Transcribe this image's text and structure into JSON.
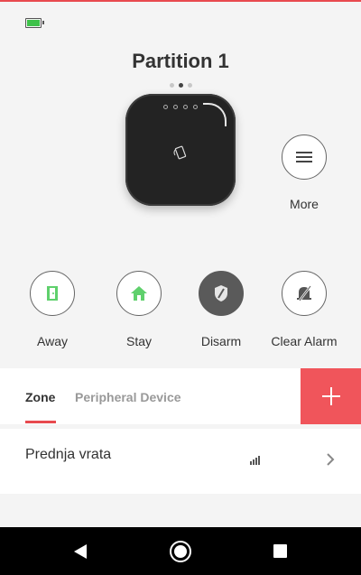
{
  "status": {
    "battery_icon": "battery-full-icon",
    "accent_color": "#e84a4f"
  },
  "header": {
    "title": "Partition 1",
    "page_indicator": {
      "count": 3,
      "active": 2
    }
  },
  "more": {
    "label": "More",
    "icon": "menu-icon"
  },
  "actions": [
    {
      "label": "Away",
      "icon": "away-door-icon",
      "active": false
    },
    {
      "label": "Stay",
      "icon": "stay-home-icon",
      "active": false
    },
    {
      "label": "Disarm",
      "icon": "disarm-shield-icon",
      "active": true
    },
    {
      "label": "Clear Alarm",
      "icon": "clear-alarm-bell-icon",
      "active": false
    }
  ],
  "tabs": [
    {
      "label": "Zone",
      "selected": true
    },
    {
      "label": "Peripheral Device",
      "selected": false
    }
  ],
  "add_button": {
    "icon": "plus-icon",
    "color": "#f0555b"
  },
  "zones": [
    {
      "name": "Prednja vrata",
      "signal_icon": "signal-strength-icon",
      "signal_bars": 4
    }
  ],
  "navbar": {
    "back_icon": "back-icon",
    "home_icon": "home-icon",
    "recents_icon": "recents-icon"
  }
}
